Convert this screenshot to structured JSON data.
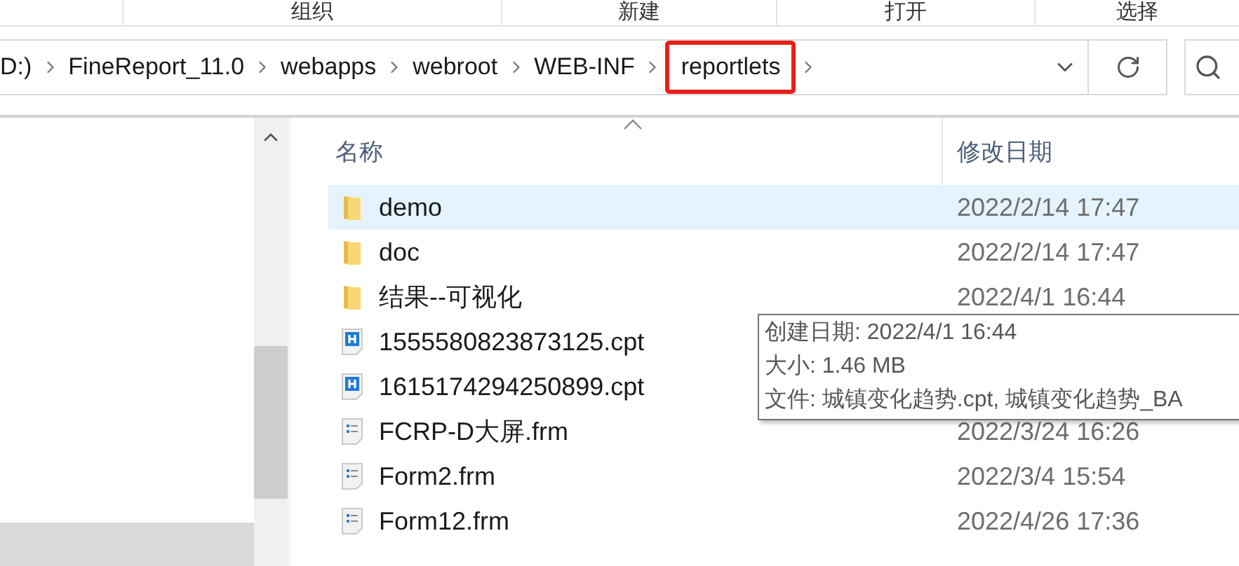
{
  "ribbon": {
    "groups": [
      "组织",
      "新建",
      "打开",
      "选择"
    ]
  },
  "address_bar": {
    "crumbs": [
      {
        "label": "D:)",
        "highlighted": false
      },
      {
        "label": "FineReport_11.0",
        "highlighted": false
      },
      {
        "label": "webapps",
        "highlighted": false
      },
      {
        "label": "webroot",
        "highlighted": false
      },
      {
        "label": "WEB-INF",
        "highlighted": false
      },
      {
        "label": "reportlets",
        "highlighted": true
      }
    ]
  },
  "file_list": {
    "columns": [
      "名称",
      "修改日期"
    ],
    "rows": [
      {
        "kind": "folder",
        "name": "demo",
        "date": "2022/2/14 17:47",
        "selected": true
      },
      {
        "kind": "folder",
        "name": "doc",
        "date": "2022/2/14 17:47",
        "selected": false
      },
      {
        "kind": "folder",
        "name": "结果--可视化",
        "date": "2022/4/1 16:44",
        "selected": false
      },
      {
        "kind": "cpt",
        "name": "1555580823873125.cpt",
        "selected": false
      },
      {
        "kind": "cpt",
        "name": "1615174294250899.cpt",
        "selected": false
      },
      {
        "kind": "frm",
        "name": "FCRP-D大屏.frm",
        "date": "2022/3/24 16:26",
        "selected": false
      },
      {
        "kind": "frm",
        "name": "Form2.frm",
        "date": "2022/3/4 15:54",
        "selected": false
      },
      {
        "kind": "frm",
        "name": "Form12.frm",
        "date": "2022/4/26 17:36",
        "selected": false
      }
    ]
  },
  "tooltip": {
    "lines": [
      "创建日期: 2022/4/1 16:44",
      "大小: 1.46 MB",
      "文件: 城镇变化趋势.cpt, 城镇变化趋势_BA"
    ]
  }
}
